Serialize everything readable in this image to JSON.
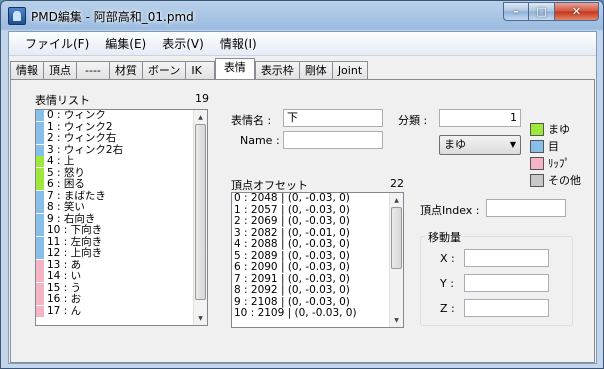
{
  "window": {
    "title": "PMD編集 - 阿部高和_01.pmd",
    "min_icon": "minimize-icon",
    "max_icon": "maximize-icon",
    "close_icon": "close-icon"
  },
  "menu": [
    "ファイル(F)",
    "編集(E)",
    "表示(V)",
    "情報(I)"
  ],
  "tabs": [
    "情報",
    "頂点",
    "----",
    "材質",
    "ボーン",
    "IK",
    "表情",
    "表示枠",
    "剛体",
    "Joint"
  ],
  "active_tab": "表情",
  "morph_list": {
    "title": "表情リスト",
    "count": "19",
    "items": [
      {
        "label": "0 : ウィンク",
        "color": "#87bfe8"
      },
      {
        "label": "1 : ウィンク2",
        "color": "#87bfe8"
      },
      {
        "label": "2 : ウィンク右",
        "color": "#87bfe8"
      },
      {
        "label": "3 : ウィンク2右",
        "color": "#87bfe8"
      },
      {
        "label": "4 : 上",
        "color": "#9de83a"
      },
      {
        "label": "5 : 怒り",
        "color": "#9de83a"
      },
      {
        "label": "6 : 困る",
        "color": "#9de83a"
      },
      {
        "label": "7 : まばたき",
        "color": "#87bfe8"
      },
      {
        "label": "8 : 笑い",
        "color": "#87bfe8"
      },
      {
        "label": "9 : 右向き",
        "color": "#87bfe8"
      },
      {
        "label": "10 : 下向き",
        "color": "#87bfe8"
      },
      {
        "label": "11 : 左向き",
        "color": "#87bfe8"
      },
      {
        "label": "12 : 上向き",
        "color": "#87bfe8"
      },
      {
        "label": "13 : あ",
        "color": "#f5b4c6"
      },
      {
        "label": "14 : い",
        "color": "#f5b4c6"
      },
      {
        "label": "15 : う",
        "color": "#f5b4c6"
      },
      {
        "label": "16 : お",
        "color": "#f5b4c6"
      },
      {
        "label": "17 : ん",
        "color": "#f5b4c6"
      }
    ]
  },
  "morph_name": {
    "label": "表情名 :",
    "value": "下"
  },
  "name_en": {
    "label": "Name :",
    "value": ""
  },
  "category": {
    "label": "分類 :",
    "value": "1",
    "selected": "まゆ"
  },
  "legend": [
    {
      "label": "まゆ",
      "color": "#9de83a"
    },
    {
      "label": "目",
      "color": "#87bfe8"
    },
    {
      "label": "ﾘｯﾌﾟ",
      "color": "#f5b4c6"
    },
    {
      "label": "その他",
      "color": "#c8c8c8"
    }
  ],
  "offsets": {
    "title": "頂点オフセット",
    "count": "22",
    "items": [
      "0 : 2048 | (0, -0.03, 0)",
      "1 : 2057 | (0, -0.03, 0)",
      "2 : 2069 | (0, -0.03, 0)",
      "3 : 2082 | (0, -0.01, 0)",
      "4 : 2088 | (0, -0.03, 0)",
      "5 : 2089 | (0, -0.03, 0)",
      "6 : 2090 | (0, -0.03, 0)",
      "7 : 2091 | (0, -0.03, 0)",
      "8 : 2092 | (0, -0.03, 0)",
      "9 : 2108 | (0, -0.03, 0)",
      "10 : 2109 | (0, -0.03, 0)"
    ]
  },
  "vertex_index": {
    "label": "頂点Index :",
    "value": ""
  },
  "movement": {
    "title": "移動量",
    "x_label": "X :",
    "y_label": "Y :",
    "z_label": "Z :",
    "x": "",
    "y": "",
    "z": ""
  }
}
